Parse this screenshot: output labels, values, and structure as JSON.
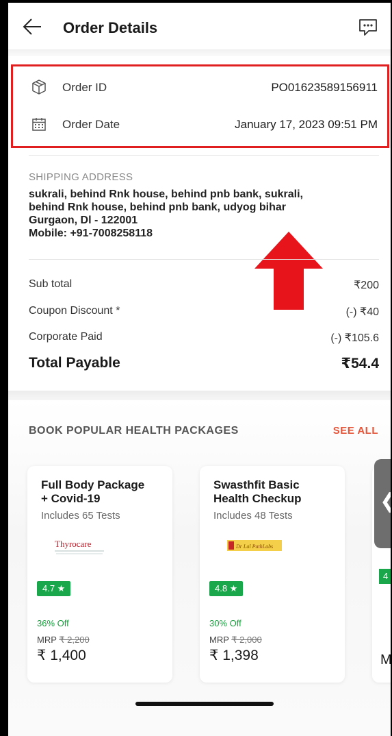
{
  "header": {
    "title": "Order Details",
    "back_icon": "arrow-left-icon",
    "chat_icon": "chat-bubble-icon"
  },
  "order_info": {
    "order_id_label": "Order ID",
    "order_id_value": "PO01623589156911",
    "order_date_label": "Order Date",
    "order_date_value": "January 17, 2023 09:51 PM"
  },
  "shipping": {
    "heading": "SHIPPING ADDRESS",
    "lines": [
      "sukrali, behind Rnk house, behind pnb bank, sukrali,",
      "behind Rnk house, behind pnb bank, udyog bihar",
      "Gurgaon, Dl - 122001",
      "Mobile: +91-7008258118"
    ]
  },
  "totals": {
    "subtotal_label": "Sub total",
    "subtotal_value": "₹200",
    "coupon_label": "Coupon Discount *",
    "coupon_value": "(-) ₹40",
    "corporate_label": "Corporate Paid",
    "corporate_value": "(-) ₹105.6",
    "payable_label": "Total Payable",
    "payable_value": "₹54.4"
  },
  "packages": {
    "heading": "BOOK POPULAR HEALTH PACKAGES",
    "see_all": "SEE ALL",
    "items": [
      {
        "title_line1": "Full Body Package",
        "title_line2": "+ Covid-19",
        "tests": "Includes 65 Tests",
        "logo_text": "Thyrocare",
        "rating": "4.7 ★",
        "discount": "36% Off",
        "mrp_label": "MRP",
        "mrp_value": "₹ 2,200",
        "price": "₹ 1,400"
      },
      {
        "title_line1": "Swasthfit Basic",
        "title_line2": "Health Checkup",
        "tests": "Includes 48 Tests",
        "logo_text": "Dr Lal PathLabs",
        "rating": "4.8 ★",
        "discount": "30% Off",
        "mrp_label": "MRP",
        "mrp_value": "₹ 2,000",
        "price": "₹ 1,398"
      }
    ],
    "partial_card": {
      "rating_fragment": "4",
      "price_fragment": "M",
      "arrow_glyph": "❮"
    }
  },
  "colors": {
    "highlight": "#e02020",
    "accent": "#e4553a",
    "rating": "#1aa64a",
    "discount": "#1a9c3e"
  }
}
